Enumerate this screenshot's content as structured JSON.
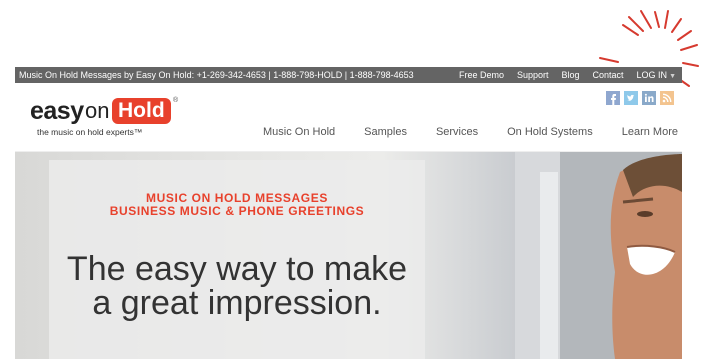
{
  "topbar": {
    "promo": "Music On Hold Messages by Easy On Hold: +1-269-342-4653 | 1-888-798-HOLD | 1-888-798-4653",
    "links": [
      "Free Demo",
      "Support",
      "Blog",
      "Contact",
      "LOG IN"
    ]
  },
  "logo": {
    "easy": "easy",
    "on": "on",
    "hold": "Hold",
    "reg": "®",
    "tagline": "the music on hold experts™"
  },
  "social": [
    "facebook-icon",
    "twitter-icon",
    "linkedin-icon",
    "rss-icon"
  ],
  "nav": [
    "Music On Hold",
    "Samples",
    "Services",
    "On Hold Systems",
    "Learn More"
  ],
  "hero": {
    "sub1": "MUSIC ON HOLD MESSAGES",
    "sub2": "BUSINESS MUSIC & PHONE GREETINGS",
    "title1": "The easy way to make",
    "title2": "a great impression."
  },
  "colors": {
    "brand_red": "#e8412c",
    "topbar": "#646464",
    "annotation": "#d63a2f"
  }
}
